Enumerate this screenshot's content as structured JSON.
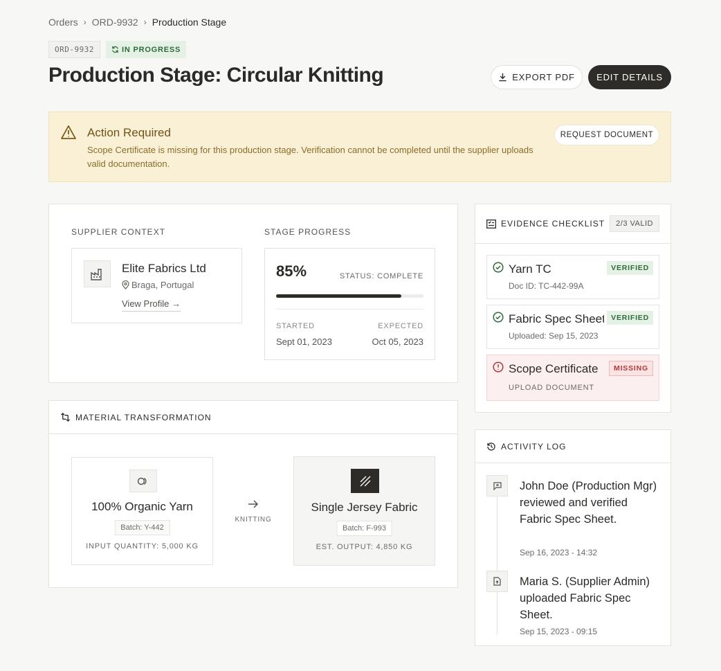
{
  "breadcrumb": {
    "items": [
      "Orders",
      "ORD-9932"
    ],
    "current": "Production Stage"
  },
  "header": {
    "order_id": "ORD-9932",
    "status": "IN PROGRESS",
    "title": "Production Stage: Circular Knitting",
    "export_label": "EXPORT PDF",
    "edit_label": "EDIT DETAILS"
  },
  "alert": {
    "title": "Action Required",
    "message": "Scope Certificate is missing for this production stage. Verification cannot be completed until the supplier uploads valid documentation.",
    "button": "REQUEST DOCUMENT",
    "colors": {
      "background": "#faf0d6",
      "text": "#8a6d28"
    }
  },
  "supplier": {
    "section_label": "SUPPLIER CONTEXT",
    "name": "Elite Fabrics Ltd",
    "location": "Braga, Portugal",
    "link": "View Profile →"
  },
  "progress": {
    "section_label": "STAGE PROGRESS",
    "percent_label": "85%",
    "percent": 85,
    "status": "STATUS: COMPLETE",
    "started_label": "STARTED",
    "started": "Sept 01, 2023",
    "expected_label": "EXPECTED",
    "expected": "Oct 05, 2023"
  },
  "material": {
    "title": "MATERIAL TRANSFORMATION",
    "input": {
      "name": "100% Organic Yarn",
      "batch": "Batch: Y-442",
      "quantity": "INPUT QUANTITY: 5,000 KG"
    },
    "process": "KNITTING",
    "output": {
      "name": "Single Jersey Fabric",
      "batch": "Batch: F-993",
      "quantity": "EST. OUTPUT: 4,850 KG"
    }
  },
  "evidence": {
    "title": "EVIDENCE CHECKLIST",
    "count": "2/3 VALID",
    "items": [
      {
        "name": "Yarn TC",
        "sub": "Doc ID: TC-442-99A",
        "badge": "VERIFIED"
      },
      {
        "name": "Fabric Spec Sheet",
        "sub": "Uploaded: Sep 15, 2023",
        "badge": "VERIFIED"
      },
      {
        "name": "Scope Certificate",
        "sub": "UPLOAD DOCUMENT",
        "badge": "MISSING"
      }
    ]
  },
  "activity": {
    "title": "ACTIVITY LOG",
    "entries": [
      {
        "icon": "comment-icon",
        "text": "John Doe (Production Mgr) reviewed and verified Fabric Spec Sheet.",
        "time": "Sep 16, 2023 - 14:32"
      },
      {
        "icon": "file-upload-icon",
        "text": "Maria S. (Supplier Admin) uploaded Fabric Spec Sheet.",
        "time": "Sep 15, 2023 - 09:15"
      }
    ]
  }
}
